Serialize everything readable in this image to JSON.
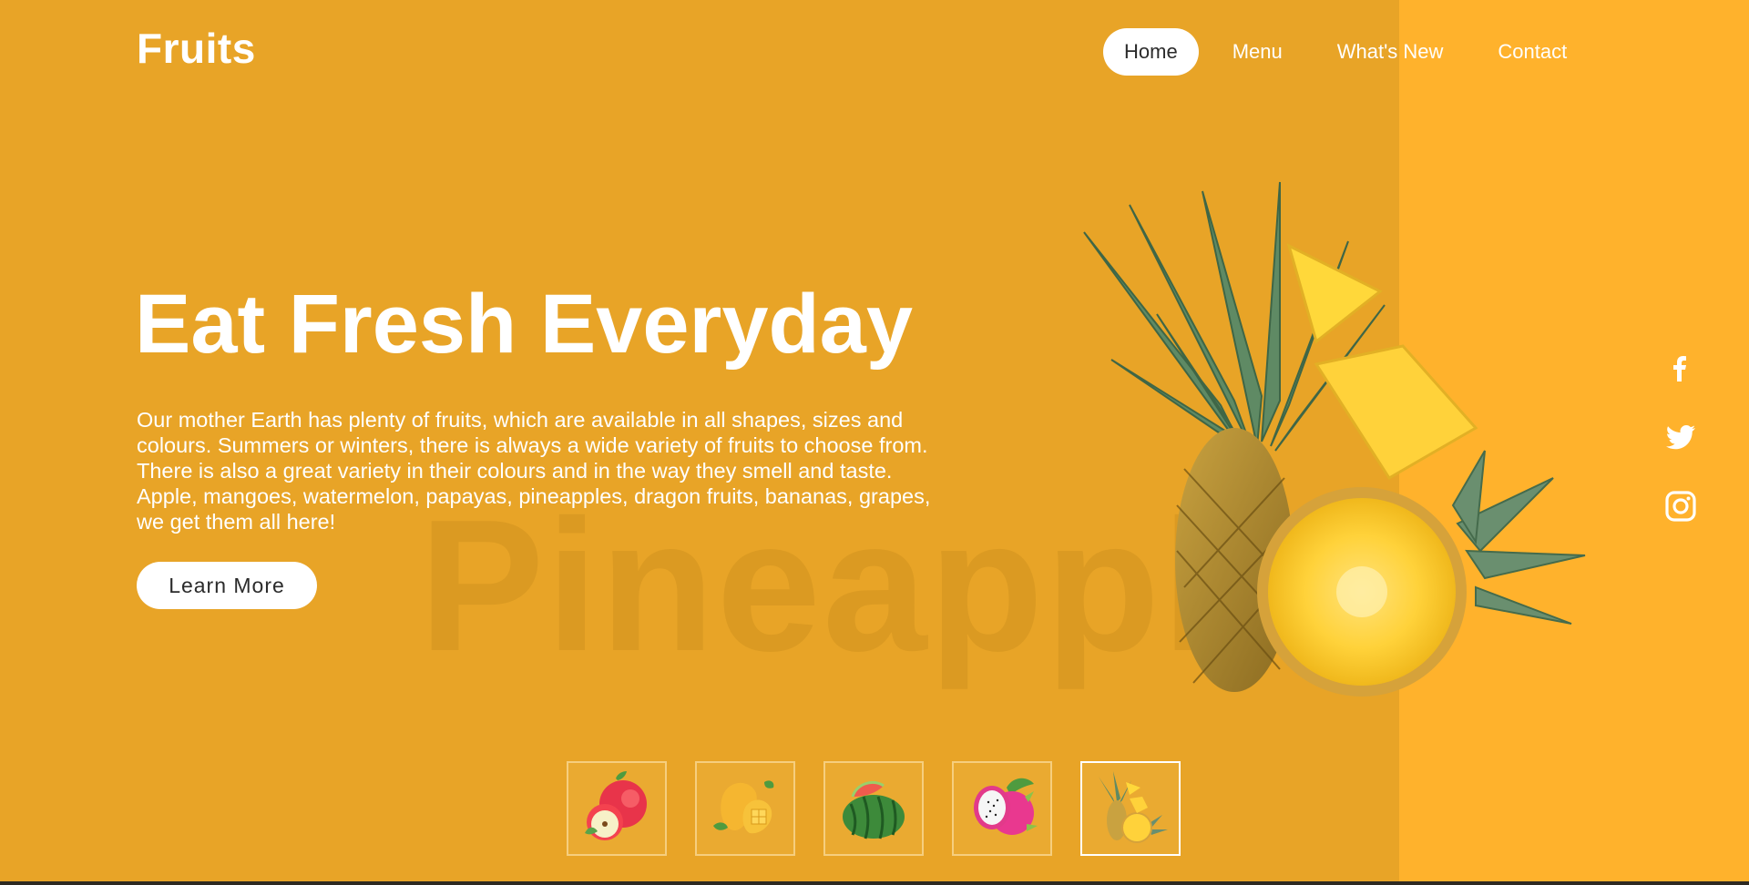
{
  "brand": {
    "logo": "Fruits"
  },
  "nav": {
    "items": [
      {
        "label": "Home",
        "active": true
      },
      {
        "label": "Menu",
        "active": false
      },
      {
        "label": "What's New",
        "active": false
      },
      {
        "label": "Contact",
        "active": false
      }
    ]
  },
  "hero": {
    "title": "Eat Fresh Everyday",
    "description": "Our mother Earth has plenty of fruits, which are available in all shapes, sizes and colours. Summers or winters, there is always a wide variety of fruits to choose from. There is also a great variety in their colours and in the way they smell and taste. Apple, mangoes, watermelon, papayas, pineapples, dragon fruits, bananas, grapes, we get them all here!",
    "cta_label": "Learn More",
    "watermark": "Pineapple",
    "featured_fruit_icon": "pineapple-icon"
  },
  "social": {
    "items": [
      "facebook-icon",
      "twitter-icon",
      "instagram-icon"
    ]
  },
  "thumbnails": {
    "items": [
      {
        "icon": "apple-icon",
        "active": false
      },
      {
        "icon": "mango-icon",
        "active": false
      },
      {
        "icon": "watermelon-icon",
        "active": false
      },
      {
        "icon": "dragon-fruit-icon",
        "active": false
      },
      {
        "icon": "pineapple-icon",
        "active": true
      }
    ]
  },
  "colors": {
    "background": "#e8a427",
    "right_panel": "#ffb22c",
    "text": "#ffffff",
    "button_bg": "#ffffff",
    "button_text": "#2b2b2b"
  }
}
